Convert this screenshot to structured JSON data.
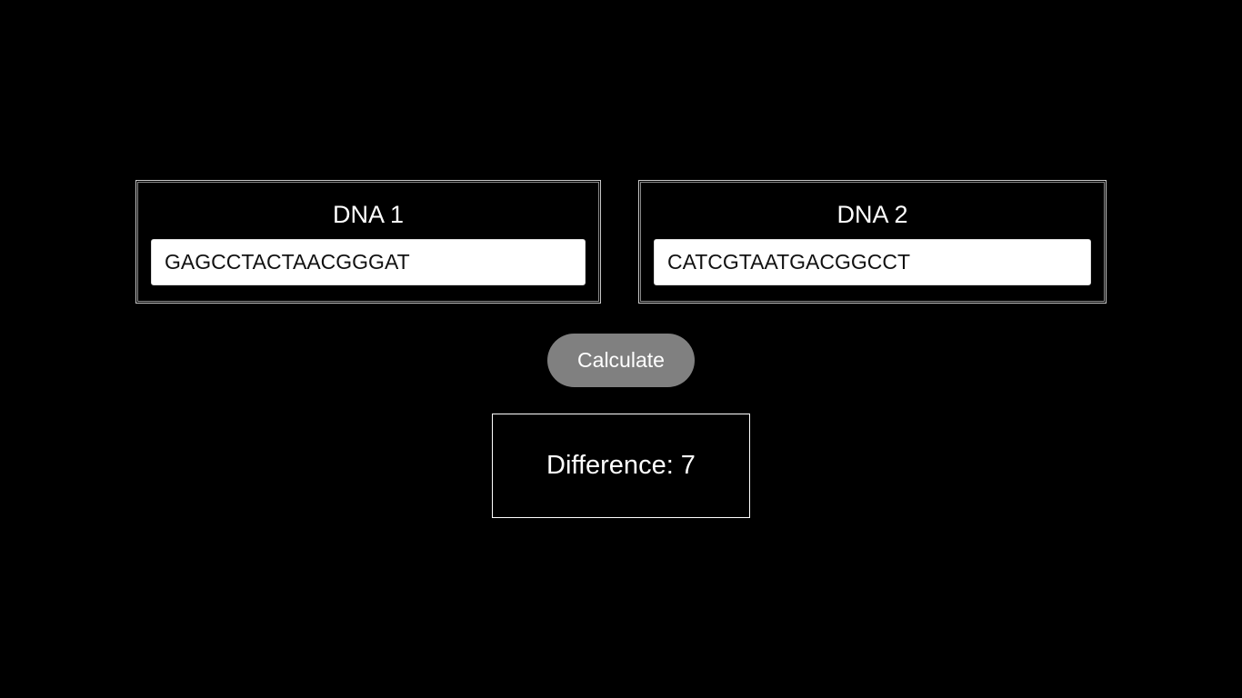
{
  "dna1": {
    "label": "DNA 1",
    "value": "GAGCCTACTAACGGGAT"
  },
  "dna2": {
    "label": "DNA 2",
    "value": "CATCGTAATGACGGCCT"
  },
  "calculate_button": {
    "label": "Calculate"
  },
  "result": {
    "text": "Difference: 7"
  },
  "colors": {
    "background": "#000000",
    "button": "#808080",
    "text": "#ffffff"
  }
}
